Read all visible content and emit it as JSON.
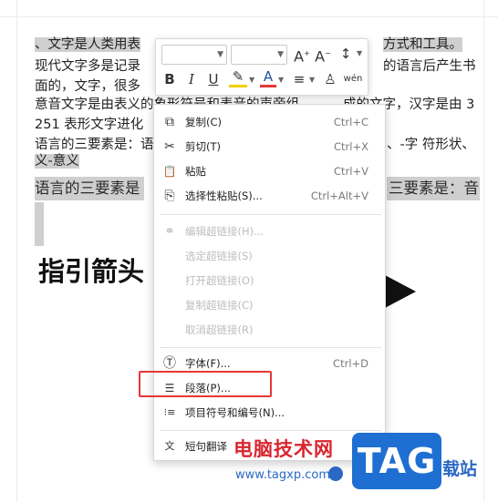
{
  "document": {
    "lines": [
      "、文字是人类用表",
      "现代文字多是记录",
      "面的，文字，很多",
      "意音文字是由表义的象形符号和表音的声旁组",
      "251 表形文字进化",
      "语言的三要素是：语",
      "义-意义"
    ],
    "line_tails": [
      "方式和工具。",
      "的语言后产生书",
      "",
      "成的文字，汉字是由 3",
      "",
      "、-字  符形状、",
      ""
    ],
    "big_line": "语言的三要素是",
    "big_line_tail": "三要素是：音",
    "heading": "指引箭头"
  },
  "mini_toolbar": {
    "font_name": "",
    "font_size": "",
    "grow_font": "A",
    "shrink_font": "A",
    "line_spacing": "↕",
    "bold": "B",
    "italic": "I",
    "underline": "U",
    "highlight": "✎",
    "font_color": "A",
    "align": "≡",
    "format_painter": "♙",
    "phonetic": "wén"
  },
  "context_menu": {
    "items": [
      {
        "icon": "copy-icon",
        "glyph": "⧉",
        "label": "复制(C)",
        "shortcut": "Ctrl+C",
        "enabled": true
      },
      {
        "icon": "cut-icon",
        "glyph": "✂",
        "label": "剪切(T)",
        "shortcut": "Ctrl+X",
        "enabled": true
      },
      {
        "icon": "paste-icon",
        "glyph": "📋",
        "label": "粘贴",
        "shortcut": "Ctrl+V",
        "enabled": true
      },
      {
        "icon": "paste-special-icon",
        "glyph": "⎘",
        "label": "选择性粘贴(S)...",
        "shortcut": "Ctrl+Alt+V",
        "enabled": true
      },
      {
        "icon": "link-icon",
        "glyph": "⚭",
        "label": "编辑超链接(H)...",
        "shortcut": "",
        "enabled": false
      },
      {
        "icon": "",
        "glyph": "",
        "label": "选定超链接(S)",
        "shortcut": "",
        "enabled": false
      },
      {
        "icon": "",
        "glyph": "",
        "label": "打开超链接(O)",
        "shortcut": "",
        "enabled": false
      },
      {
        "icon": "",
        "glyph": "",
        "label": "复制超链接(C)",
        "shortcut": "",
        "enabled": false
      },
      {
        "icon": "",
        "glyph": "",
        "label": "取消超链接(R)",
        "shortcut": "",
        "enabled": false
      },
      {
        "icon": "font-icon",
        "glyph": "Ⓣ",
        "label": "字体(F)...",
        "shortcut": "Ctrl+D",
        "enabled": true
      },
      {
        "icon": "paragraph-icon",
        "glyph": "☰",
        "label": "段落(P)...",
        "shortcut": "",
        "enabled": true
      },
      {
        "icon": "bullets-icon",
        "glyph": "⁝≡",
        "label": "项目符号和编号(N)...",
        "shortcut": "",
        "enabled": true
      },
      {
        "icon": "translate-icon",
        "glyph": "文",
        "label": "短句翻译",
        "shortcut": "",
        "enabled": true,
        "submenu": true
      }
    ]
  },
  "watermark": {
    "site_name": "电脑技术网",
    "url": "www.tagxp.com",
    "logo_text": "TAG",
    "suffix": "载站"
  },
  "colors": {
    "selection": "#cfcfcf",
    "highlight_border": "#e53935",
    "watermark_red": "#d8262f",
    "watermark_blue": "#1f6fd2"
  }
}
